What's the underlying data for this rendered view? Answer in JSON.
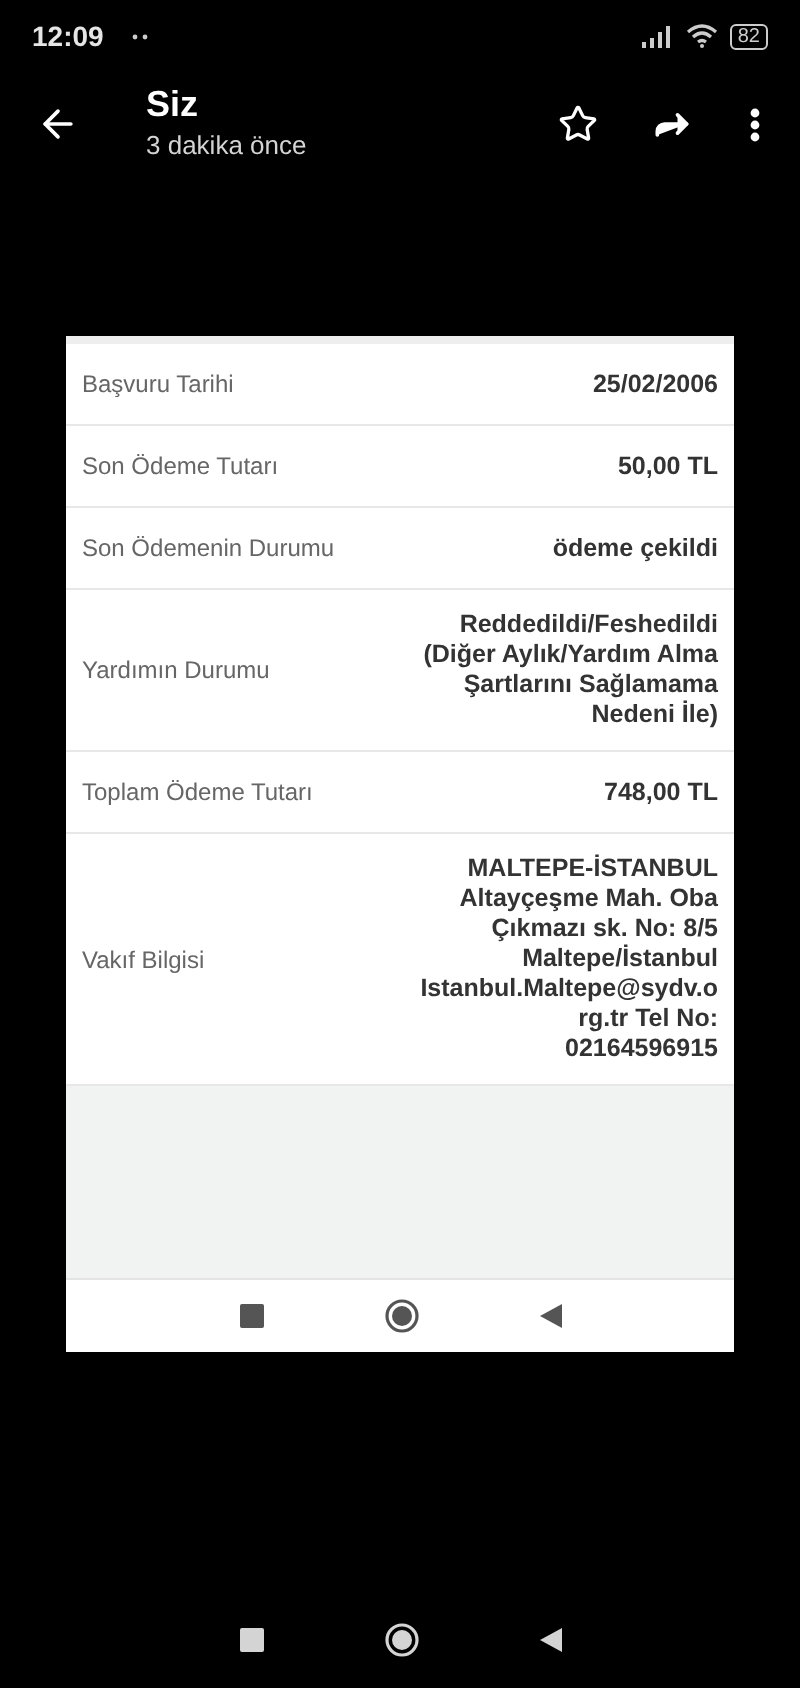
{
  "status_bar": {
    "time": "12:09",
    "battery": "82"
  },
  "header": {
    "title": "Siz",
    "subtitle": "3 dakika önce"
  },
  "rows": [
    {
      "label": "Başvuru Tarihi",
      "lines": [
        "25/02/2006"
      ]
    },
    {
      "label": "Son Ödeme Tutarı",
      "lines": [
        "50,00 TL"
      ]
    },
    {
      "label": "Son Ödemenin Durumu",
      "lines": [
        "ödeme çekildi"
      ]
    },
    {
      "label": "Yardımın Durumu",
      "lines": [
        "Reddedildi/Feshedildi",
        "(Diğer Aylık/Yardım Alma",
        "Şartlarını Sağlamama",
        "Nedeni İle)"
      ]
    },
    {
      "label": "Toplam Ödeme Tutarı",
      "lines": [
        "748,00 TL"
      ]
    },
    {
      "label": "Vakıf Bilgisi",
      "lines": [
        "MALTEPE-İSTANBUL",
        "Altayçeşme Mah. Oba",
        "Çıkmazı sk. No: 8/5",
        "Maltepe/İstanbul",
        "Istanbul.Maltepe@sydv.o",
        "rg.tr Tel No:",
        "02164596915"
      ]
    }
  ]
}
